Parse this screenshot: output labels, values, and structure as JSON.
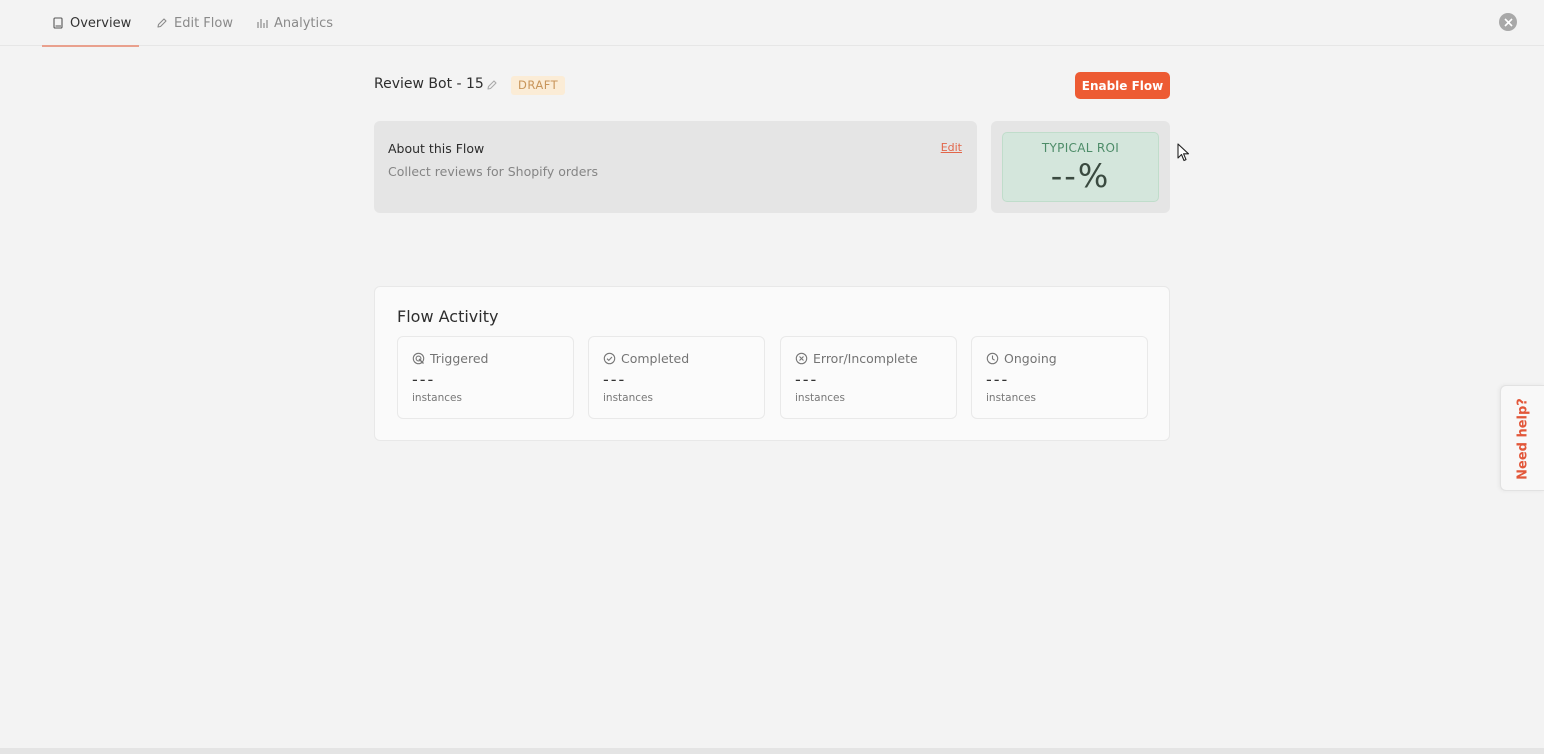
{
  "tabs": [
    {
      "label": "Overview",
      "icon": "book-icon",
      "active": true
    },
    {
      "label": "Edit Flow",
      "icon": "pencil-icon",
      "active": false
    },
    {
      "label": "Analytics",
      "icon": "bar-chart-icon",
      "active": false
    }
  ],
  "header": {
    "title": "Review Bot - 15",
    "status_badge": "DRAFT",
    "enable_button": "Enable Flow"
  },
  "about": {
    "title": "About this Flow",
    "description": "Collect reviews for Shopify orders",
    "edit_link": "Edit"
  },
  "roi": {
    "label": "TYPICAL ROI",
    "value": "--%"
  },
  "activity": {
    "title": "Flow Activity",
    "stats": [
      {
        "label": "Triggered",
        "value": "---",
        "unit": "instances",
        "icon": "trigger-icon"
      },
      {
        "label": "Completed",
        "value": "---",
        "unit": "instances",
        "icon": "check-circle-icon"
      },
      {
        "label": "Error/Incomplete",
        "value": "---",
        "unit": "instances",
        "icon": "x-circle-icon"
      },
      {
        "label": "Ongoing",
        "value": "---",
        "unit": "instances",
        "icon": "clock-icon"
      }
    ]
  },
  "help": {
    "label": "Need help?"
  },
  "colors": {
    "accent": "#ed5b33",
    "roi_bg": "#d4e6dc",
    "draft_bg": "#fbecd6"
  }
}
